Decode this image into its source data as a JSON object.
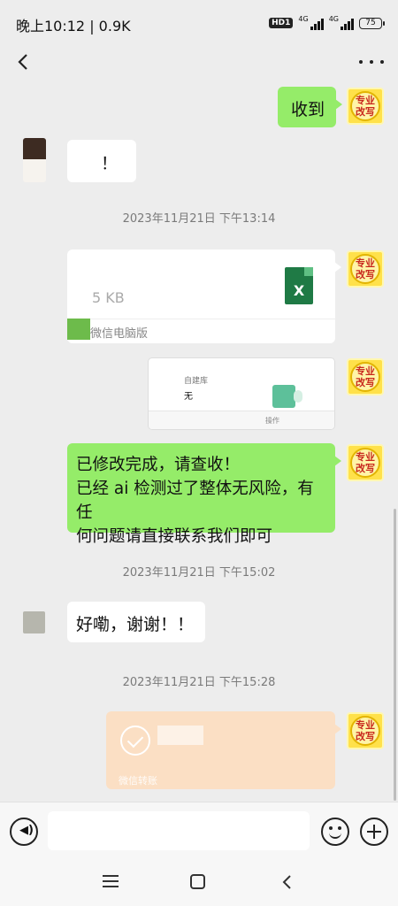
{
  "status": {
    "time": "晚上10:12 | 0.9K",
    "hd": "HD1",
    "net1": "4G",
    "net2": "4G",
    "battery": "75"
  },
  "nav": {
    "back_icon": "back-icon",
    "more_icon": "more-icon"
  },
  "avatars": {
    "pro_line1": "专业",
    "pro_line2": "改写"
  },
  "messages": {
    "m1_text": "收到",
    "m2_text": "！",
    "ts1": "2023年11月21日 下午13:14",
    "file_size": "5 KB",
    "file_type": "X",
    "file_footer": "微信电脑版",
    "shot_label": "自建库",
    "shot_value": "无",
    "shot_op": "操作",
    "long_line1": "已修改完成，请查收！",
    "long_line2": "已经 ai 检测过了整体无风险，有任",
    "long_line3": "何问题请直接联系我们即可",
    "ts2": "2023年11月21日 下午15:02",
    "m_reply": "好嘞，谢谢！！",
    "ts3": "2023年11月21日 下午15:28",
    "transfer_label": "微信转账"
  },
  "input": {
    "placeholder": ""
  },
  "colors": {
    "bubble_green": "#95ec69",
    "background": "#ededed",
    "transfer": "#fbdfc4"
  }
}
